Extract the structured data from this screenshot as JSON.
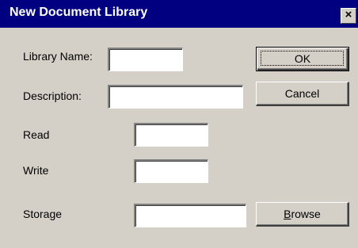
{
  "dialog": {
    "title": "New Document Library",
    "close_glyph": "×"
  },
  "form": {
    "library_name_label": "Library Name:",
    "library_name_value": "",
    "description_label": "Description:",
    "description_value": "",
    "read_label": "Read",
    "read_value": "",
    "write_label": "Write",
    "write_value": "",
    "storage_label": "Storage",
    "storage_value": ""
  },
  "buttons": {
    "ok_label": "OK",
    "cancel_label": "Cancel",
    "browse_accel": "B",
    "browse_rest": "rowse"
  },
  "colors": {
    "titlebar": "#000080",
    "face": "#d4d0c8",
    "field": "#ffffff"
  }
}
